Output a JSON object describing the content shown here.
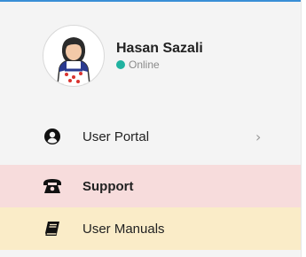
{
  "user": {
    "name": "Hasan Sazali",
    "status": "Online",
    "status_color": "#20b2a0"
  },
  "menu": {
    "items": [
      {
        "label": "User Portal",
        "icon": "user-circle-icon",
        "has_chevron": true,
        "chevron": "›",
        "background": "#f4f4f4",
        "active": false
      },
      {
        "label": "Support",
        "icon": "phone-icon",
        "has_chevron": false,
        "background": "#f7dcdc",
        "active": true
      },
      {
        "label": "User Manuals",
        "icon": "book-icon",
        "has_chevron": false,
        "background": "#faecc8",
        "active": false
      }
    ]
  },
  "colors": {
    "accent_top_border": "#3a8fd6",
    "panel_background": "#f4f4f4"
  }
}
